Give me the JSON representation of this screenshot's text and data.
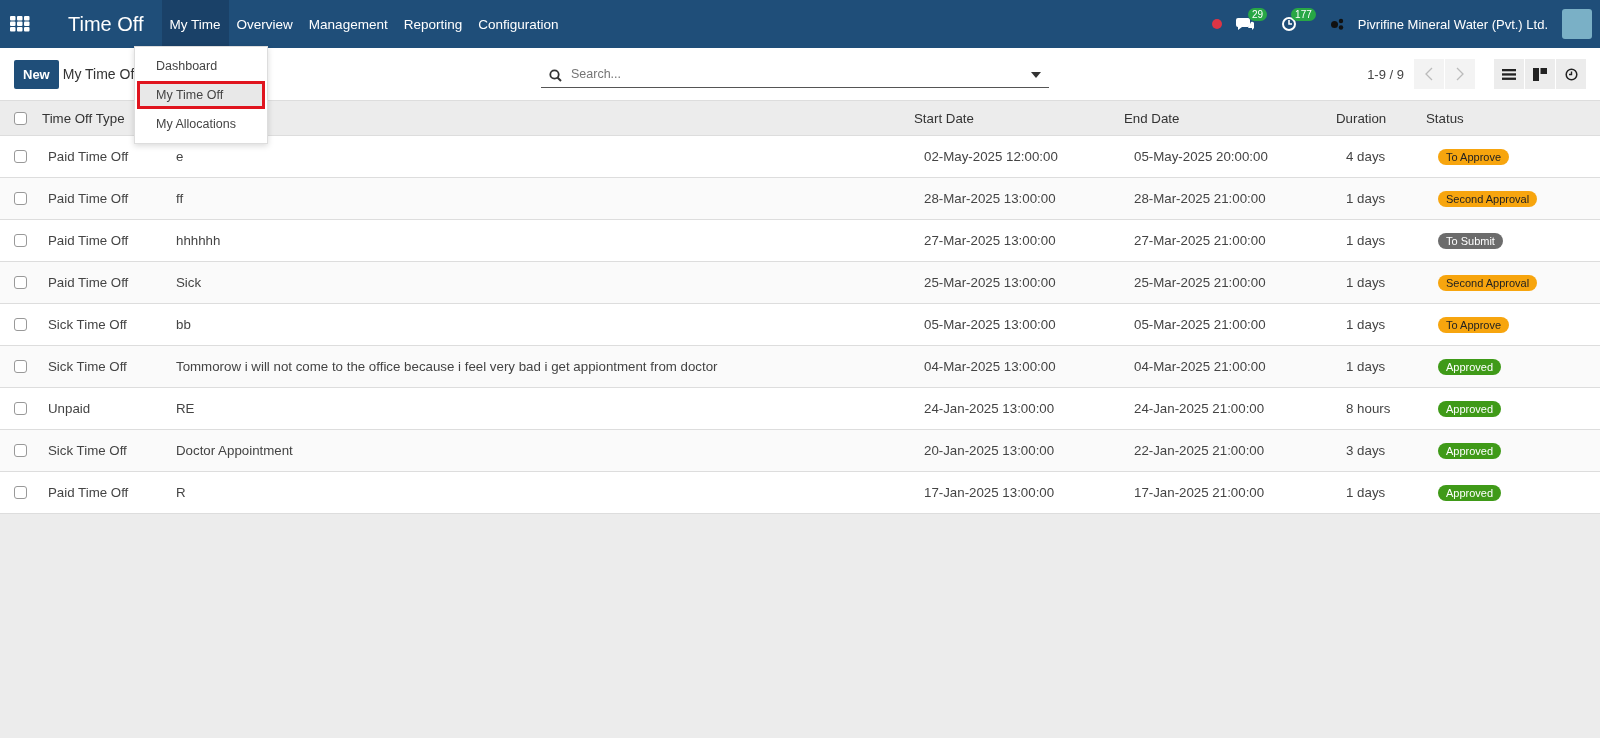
{
  "navbar": {
    "app_title": "Time Off",
    "menus": [
      {
        "label": "My Time",
        "expanded": true
      },
      {
        "label": "Overview",
        "expanded": false
      },
      {
        "label": "Management",
        "expanded": false
      },
      {
        "label": "Reporting",
        "expanded": false
      },
      {
        "label": "Configuration",
        "expanded": false
      }
    ],
    "dropdown": [
      {
        "label": "Dashboard",
        "selected": false
      },
      {
        "label": "My Time Off",
        "selected": true
      },
      {
        "label": "My Allocations",
        "selected": false
      }
    ],
    "messages_count": "29",
    "activities_count": "177",
    "company": "Pivrifine Mineral Water (Pvt.) Ltd."
  },
  "control_panel": {
    "new_button": "New",
    "breadcrumb": "My Time Of",
    "search": {
      "placeholder": "Search..."
    },
    "pager": "1-9 / 9"
  },
  "table": {
    "all_checked": false,
    "columns": [
      "Time Off Type",
      "",
      "Start Date",
      "End Date",
      "Duration",
      "Status"
    ],
    "rows": [
      {
        "checked": false,
        "type": "Paid Time Off",
        "description": "e",
        "start": "02-May-2025 12:00:00",
        "end": "05-May-2025 20:00:00",
        "duration": "4 days",
        "status": "To Approve",
        "color": "#f7a50e"
      },
      {
        "checked": false,
        "type": "Paid Time Off",
        "description": "ff",
        "start": "28-Mar-2025 13:00:00",
        "end": "28-Mar-2025 21:00:00",
        "duration": "1 days",
        "status": "Second Approval",
        "color": "#f7a50e"
      },
      {
        "checked": false,
        "type": "Paid Time Off",
        "description": "hhhhhh",
        "start": "27-Mar-2025 13:00:00",
        "end": "27-Mar-2025 21:00:00",
        "duration": "1 days",
        "status": "To Submit",
        "color": "#6c6c6c"
      },
      {
        "checked": false,
        "type": "Paid Time Off",
        "description": "Sick",
        "start": "25-Mar-2025 13:00:00",
        "end": "25-Mar-2025 21:00:00",
        "duration": "1 days",
        "status": "Second Approval",
        "color": "#f7a50e"
      },
      {
        "checked": false,
        "type": "Sick Time Off",
        "description": "bb",
        "start": "05-Mar-2025 13:00:00",
        "end": "05-Mar-2025 21:00:00",
        "duration": "1 days",
        "status": "To Approve",
        "color": "#f7a50e"
      },
      {
        "checked": false,
        "type": "Sick Time Off",
        "description": "Tommorow i will not come to the office because i feel very bad i get appiontment from doctor",
        "start": "04-Mar-2025 13:00:00",
        "end": "04-Mar-2025 21:00:00",
        "duration": "1 days",
        "status": "Approved",
        "color": "#3f9a18"
      },
      {
        "checked": false,
        "type": "Unpaid",
        "description": "RE",
        "start": "24-Jan-2025 13:00:00",
        "end": "24-Jan-2025 21:00:00",
        "duration": "8 hours",
        "status": "Approved",
        "color": "#3f9a18"
      },
      {
        "checked": false,
        "type": "Sick Time Off",
        "description": "Doctor Appointment",
        "start": "20-Jan-2025 13:00:00",
        "end": "22-Jan-2025 21:00:00",
        "duration": "3 days",
        "status": "Approved",
        "color": "#3f9a18"
      },
      {
        "checked": false,
        "type": "Paid Time Off",
        "description": "R",
        "start": "17-Jan-2025 13:00:00",
        "end": "17-Jan-2025 21:00:00",
        "duration": "1 days",
        "status": "Approved",
        "color": "#3f9a18"
      }
    ]
  }
}
